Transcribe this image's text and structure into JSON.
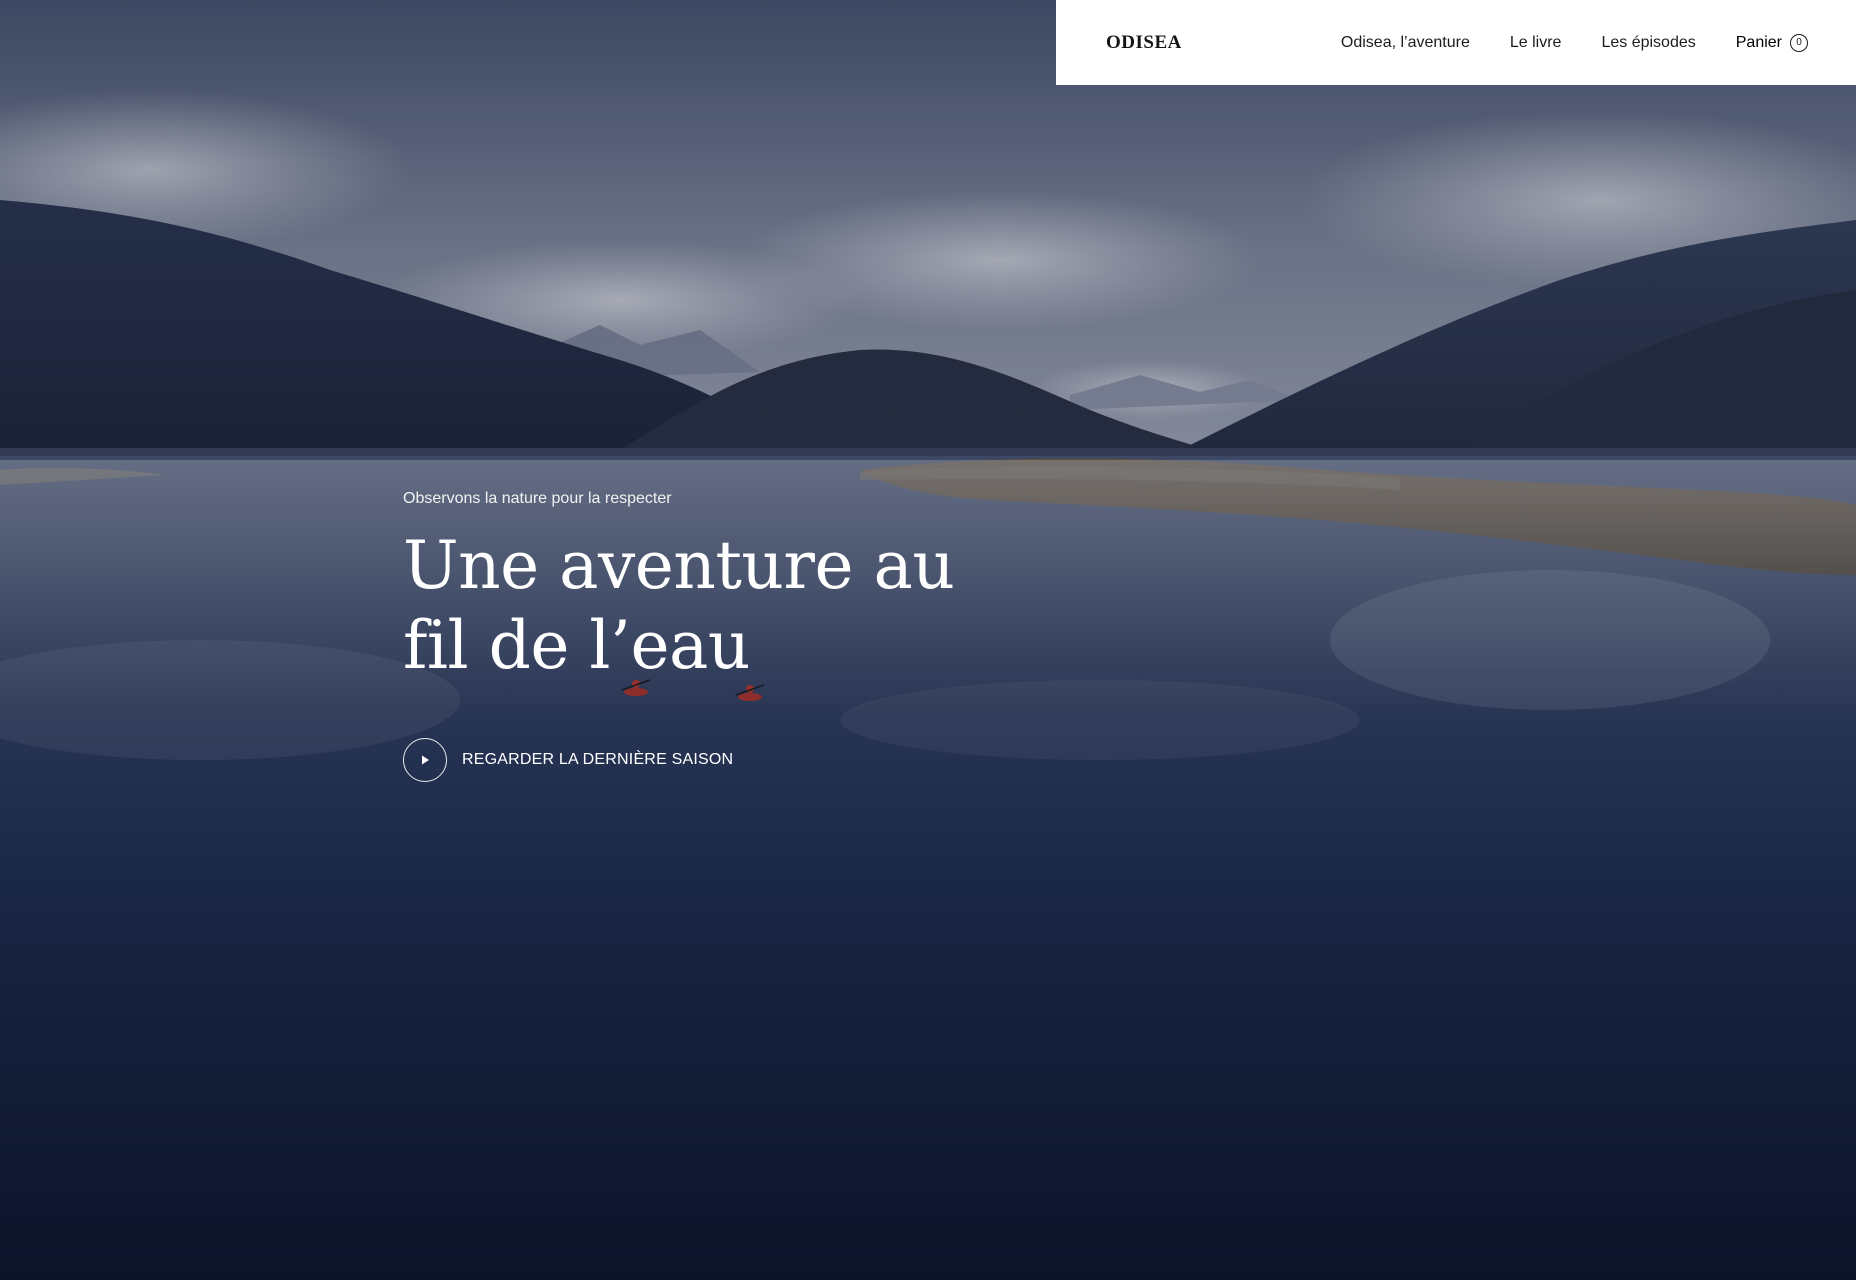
{
  "header": {
    "logo": "ODISEA",
    "nav": [
      {
        "label": "Odisea, l’aventure"
      },
      {
        "label": "Le livre"
      },
      {
        "label": "Les épisodes"
      }
    ],
    "cart": {
      "label": "Panier",
      "count": "0"
    }
  },
  "hero": {
    "eyebrow": "Observons la nature pour la respecter",
    "headline_line1": "Une aventure au",
    "headline_line2": "fil de l’eau",
    "cta_label": "REGARDER LA DERNIÈRE SAISON",
    "background": "lake-with-mountains-and-kayaks"
  },
  "colors": {
    "header_bg": "#ffffff",
    "text_dark": "#1c1c1c",
    "text_light": "#ffffff",
    "kayak": "#c0392b"
  },
  "icons": {
    "play": "play-icon"
  }
}
